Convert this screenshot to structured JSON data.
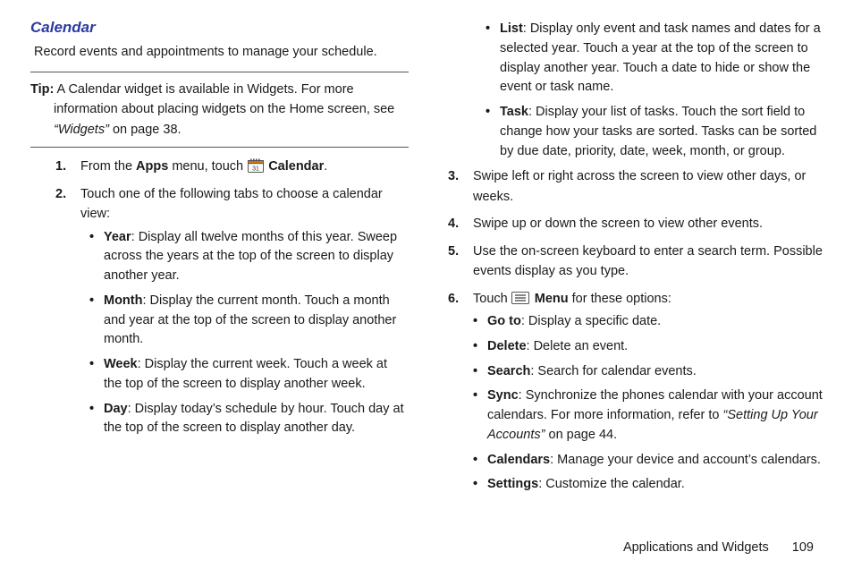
{
  "heading": "Calendar",
  "intro": "Record events and appointments to manage your schedule.",
  "tip": {
    "label": "Tip:",
    "body_a": "A Calendar widget is available in Widgets. For more information about placing widgets on the Home screen, see ",
    "link": "“Widgets”",
    "body_b": " on page 38."
  },
  "step1": {
    "pre": "From the ",
    "apps": "Apps",
    "mid": " menu, touch ",
    "app_label": "Calendar",
    "post": "."
  },
  "step2_text": "Touch one of the following tabs to choose a calendar view:",
  "views": {
    "year": {
      "name": "Year",
      "desc": ": Display all twelve months of this year. Sweep across the years at the top of the screen to display another year."
    },
    "month": {
      "name": "Month",
      "desc": ": Display the current month. Touch a month and year at the top of the screen to display another month."
    },
    "week": {
      "name": "Week",
      "desc": ": Display the current week. Touch a week at the top of the screen to display another week."
    },
    "day": {
      "name": "Day",
      "desc": ": Display today’s schedule by hour. Touch day at the top of the screen to display another day."
    },
    "list": {
      "name": "List",
      "desc": ": Display only event and task names and dates for a selected year. Touch a year at the top of the screen to display another year. Touch a date to hide or show the event or task name."
    },
    "task": {
      "name": "Task",
      "desc": ": Display your list of tasks. Touch the sort field to change how your tasks are sorted. Tasks can be sorted by due date, priority, date, week, month, or group."
    }
  },
  "step3": "Swipe left or right across the screen to view other days, or weeks.",
  "step4": "Swipe up or down the screen to view other events.",
  "step5": "Use the on-screen keyboard to enter a search term. Possible events display as you type.",
  "step6": {
    "pre": "Touch ",
    "menu": "Menu",
    "post": " for these options:"
  },
  "menu": {
    "goto": {
      "name": "Go to",
      "desc": ": Display a specific date."
    },
    "delete": {
      "name": "Delete",
      "desc": ": Delete an event."
    },
    "search": {
      "name": "Search",
      "desc": ": Search for calendar events."
    },
    "sync": {
      "name": "Sync",
      "desc_a": ": Synchronize the phones calendar with your account calendars. For more information, refer to ",
      "link": "“Setting Up Your Accounts”",
      "desc_b": " on page 44."
    },
    "calendars": {
      "name": "Calendars",
      "desc": ": Manage your device and account’s calendars."
    },
    "settings": {
      "name": "Settings",
      "desc": ": Customize the calendar."
    }
  },
  "footer": {
    "section": "Applications and Widgets",
    "page": "109"
  }
}
